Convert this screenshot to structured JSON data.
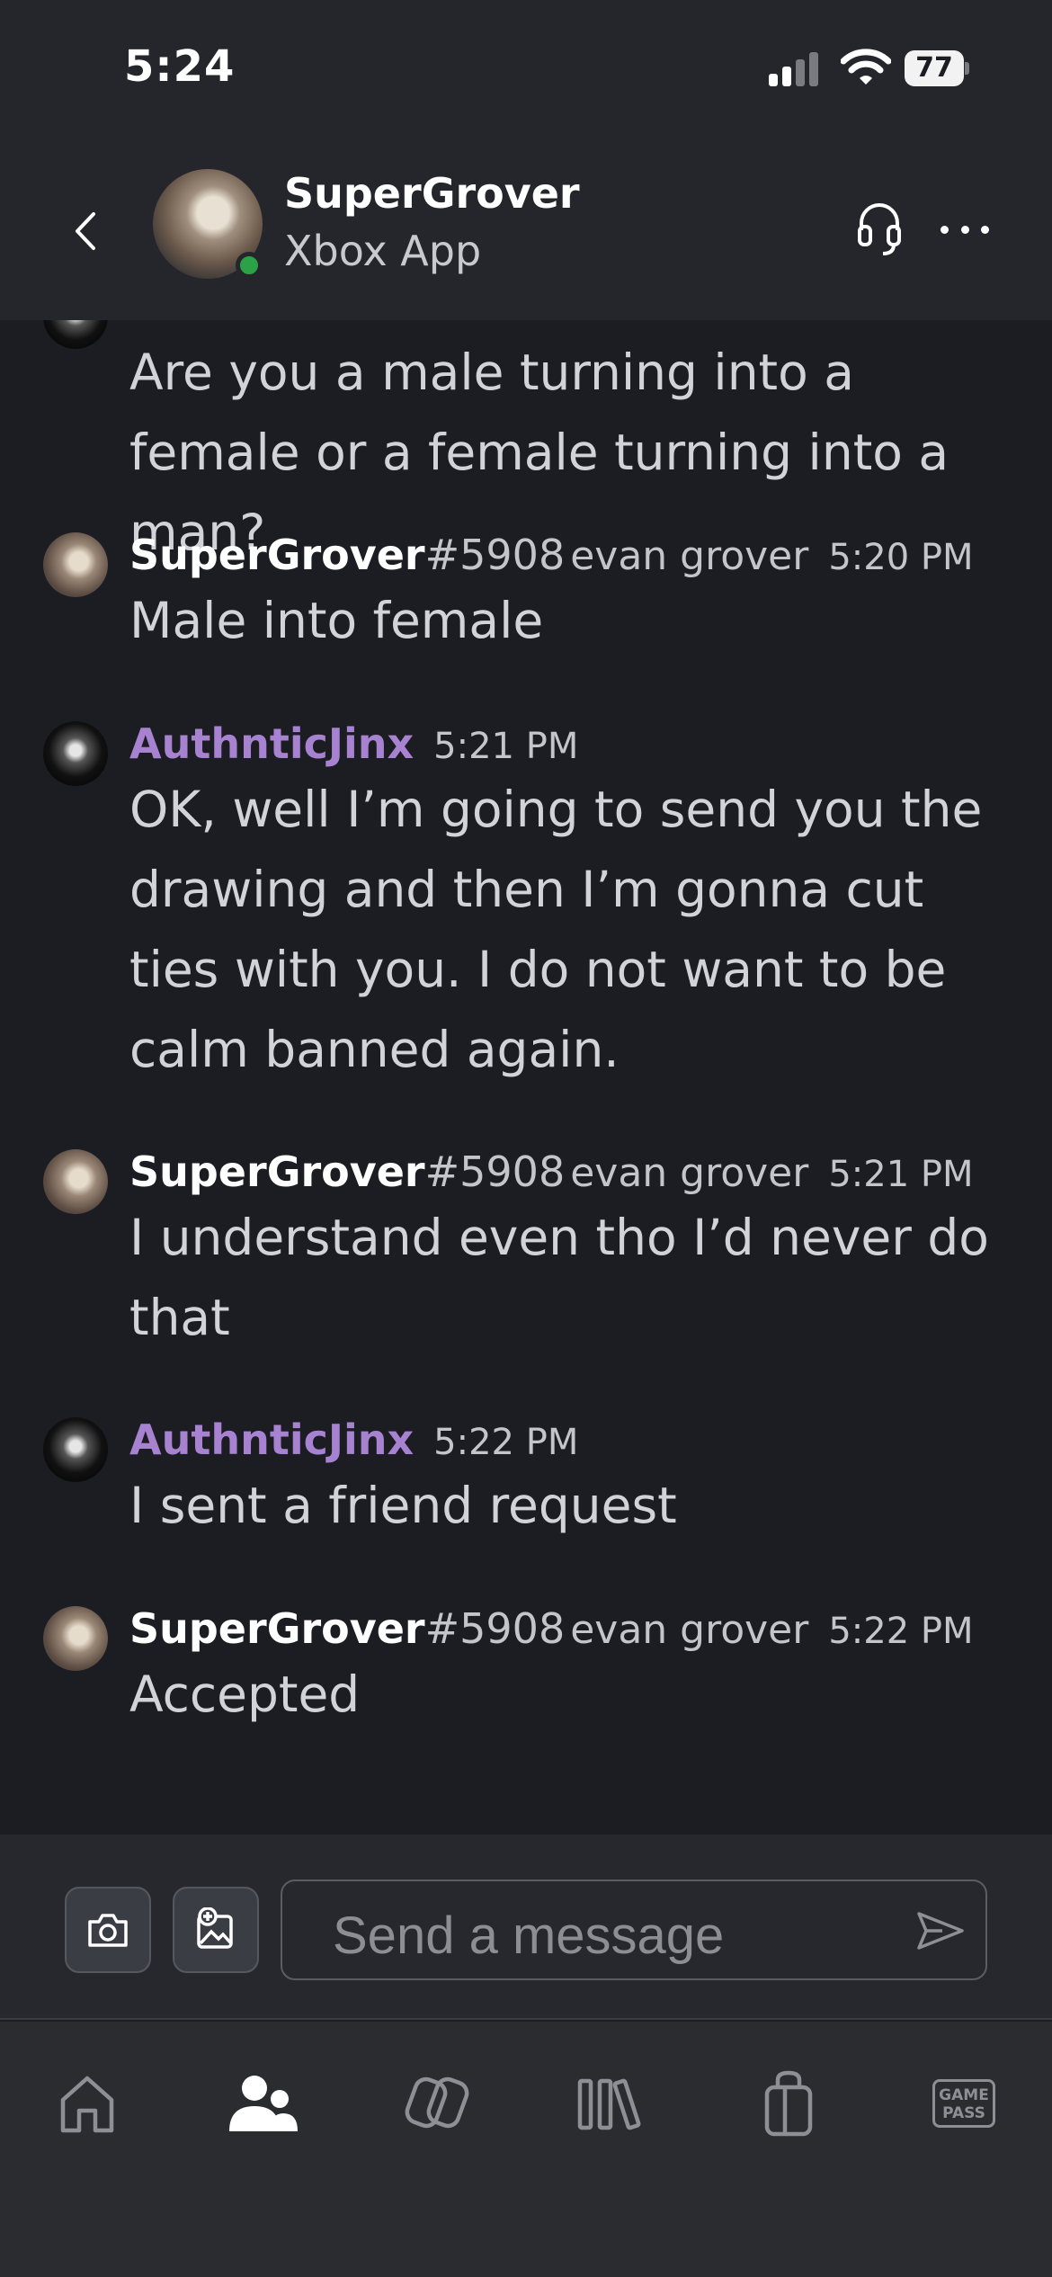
{
  "status_bar": {
    "time": "5:24",
    "battery": "77"
  },
  "header": {
    "name": "SuperGrover",
    "subtitle": "Xbox App",
    "presence": "online",
    "presence_color": "#2aa245"
  },
  "messages": [
    {
      "continued": true,
      "body": "Are you a male turning into a female or a female turning into a man?"
    },
    {
      "username": "SuperGrover",
      "tag": "#5908",
      "real_name": "evan grover",
      "time": "5:20 PM",
      "body": "Male into female"
    },
    {
      "username": "AuthnticJinx",
      "time": "5:21 PM",
      "body": "OK, well I’m going to send you the drawing and then I’m gonna cut ties with you. I do not want to be calm banned again."
    },
    {
      "username": "SuperGrover",
      "tag": "#5908",
      "real_name": "evan grover",
      "time": "5:21 PM",
      "body": "I understand even tho I’d never do that"
    },
    {
      "username": "AuthnticJinx",
      "time": "5:22 PM",
      "body": "I sent a friend request"
    },
    {
      "username": "SuperGrover",
      "tag": "#5908",
      "real_name": "evan grover",
      "time": "5:22 PM",
      "body": "Accepted"
    }
  ],
  "composer": {
    "placeholder": "Send a message"
  },
  "bottom_nav": {
    "items": [
      "home-icon",
      "friends-icon",
      "social-icon",
      "library-icon",
      "store-icon",
      "game-pass-icon"
    ],
    "active": "friends-icon",
    "game_pass_label": "GAME PASS"
  },
  "colors": {
    "accent_purple": "#a782d0",
    "background": "#1c1d22",
    "header": "#24262c"
  }
}
